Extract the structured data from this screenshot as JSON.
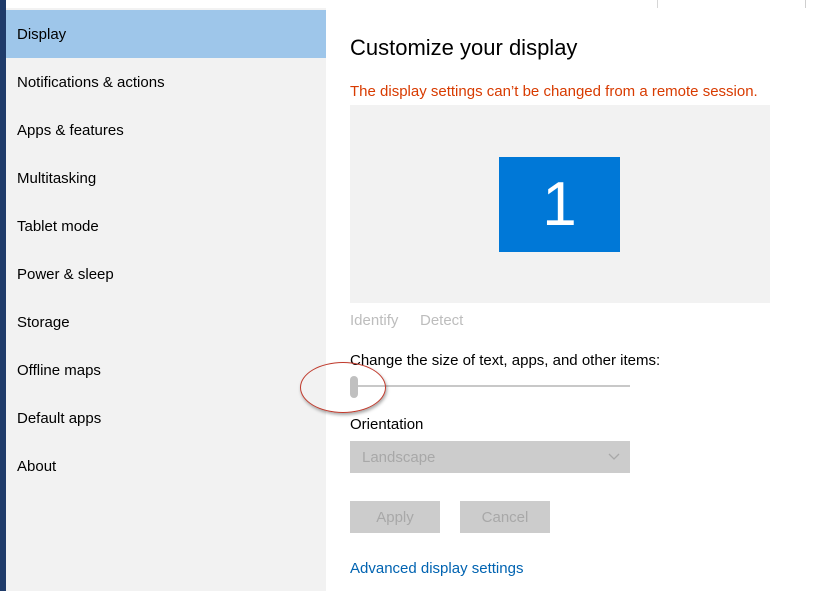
{
  "sidebar": {
    "items": [
      {
        "label": "Display",
        "selected": true
      },
      {
        "label": "Notifications & actions",
        "selected": false
      },
      {
        "label": "Apps & features",
        "selected": false
      },
      {
        "label": "Multitasking",
        "selected": false
      },
      {
        "label": "Tablet mode",
        "selected": false
      },
      {
        "label": "Power & sleep",
        "selected": false
      },
      {
        "label": "Storage",
        "selected": false
      },
      {
        "label": "Offline maps",
        "selected": false
      },
      {
        "label": "Default apps",
        "selected": false
      },
      {
        "label": "About",
        "selected": false
      }
    ]
  },
  "main": {
    "title": "Customize your display",
    "warning": "The display settings can’t be changed from a remote session.",
    "monitor_number": "1",
    "identify_label": "Identify",
    "detect_label": "Detect",
    "scale_label": "Change the size of text, apps, and other items:",
    "scale_value": 0,
    "orientation_label": "Orientation",
    "orientation_value": "Landscape",
    "apply_label": "Apply",
    "cancel_label": "Cancel",
    "advanced_link": "Advanced display settings"
  },
  "colors": {
    "accent": "#0078d7",
    "selected_nav": "#9ec6ea",
    "warning": "#d83b01",
    "link": "#0063b1",
    "annotation": "#c0392b"
  }
}
